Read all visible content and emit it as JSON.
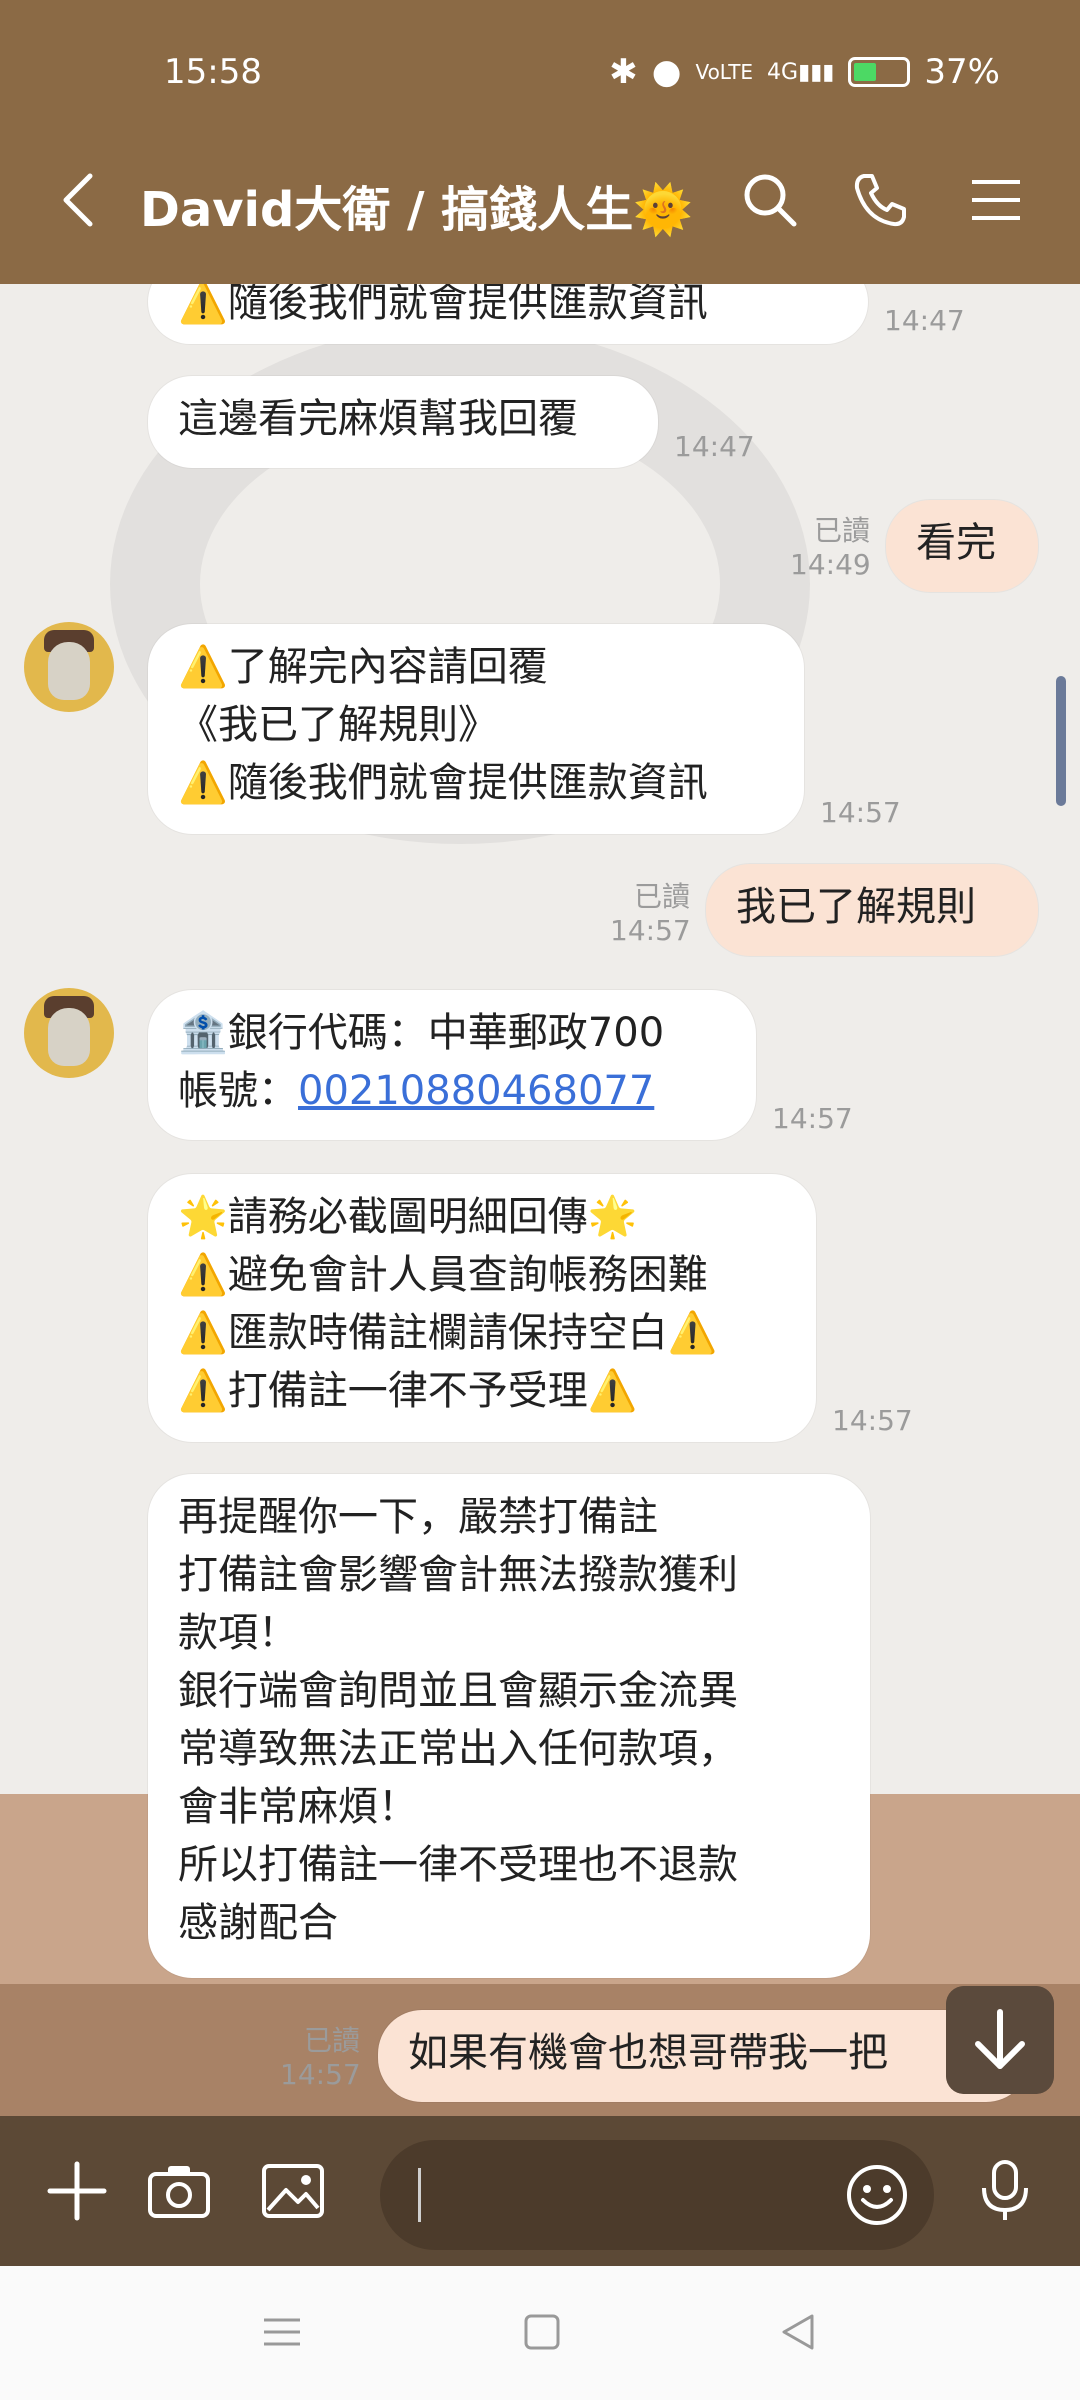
{
  "status_bar": {
    "time": "15:58",
    "battery": "37%"
  },
  "header": {
    "title": "David大衛 / 搞錢人生🌞"
  },
  "messages": [
    {
      "side": "left",
      "lines": [
        "⚠️隨後我們就會提供匯款資訊"
      ],
      "time": "14:47"
    },
    {
      "side": "left",
      "lines": [
        "這邊看完麻煩幫我回覆"
      ],
      "time": "14:47"
    },
    {
      "side": "right",
      "lines": [
        "看完"
      ],
      "read": "已讀",
      "time": "14:49"
    },
    {
      "side": "left",
      "lines": [
        "⚠️了解完內容請回覆",
        "《我已了解規則》",
        "⚠️隨後我們就會提供匯款資訊"
      ],
      "time": "14:57"
    },
    {
      "side": "right",
      "lines": [
        "我已了解規則"
      ],
      "read": "已讀",
      "time": "14:57"
    },
    {
      "side": "left",
      "lines": [
        "🏦銀行代碼：中華郵政700",
        "帳號：",
        "00210880468077"
      ],
      "time": "14:57"
    },
    {
      "side": "left",
      "lines": [
        "🌟請務必截圖明細回傳🌟",
        "⚠️避免會計人員查詢帳務困難",
        "⚠️匯款時備註欄請保持空白⚠️",
        "⚠️打備註一律不予受理⚠️"
      ],
      "time": "14:57"
    },
    {
      "side": "left",
      "lines": [
        "再提醒你一下，嚴禁打備註",
        "打備註會影響會計無法撥款獲利",
        "款項！",
        "銀行端會詢問並且會顯示金流異",
        "常導致無法正常出入任何款項，",
        "會非常麻煩！",
        "所以打備註一律不受理也不退款",
        "感謝配合"
      ]
    },
    {
      "side": "right",
      "lines": [
        "如果有機會也想哥帶我一把"
      ],
      "read": "已讀",
      "time": "14:57"
    }
  ],
  "icons": {
    "back": "back-arrow-icon",
    "search": "search-icon",
    "call": "phone-icon",
    "menu": "menu-icon",
    "add": "plus-icon",
    "camera": "camera-icon",
    "gallery": "image-icon",
    "emoji": "emoji-icon",
    "mic": "mic-icon",
    "jump": "arrow-down-icon"
  },
  "colors": {
    "header": "#8b6a45",
    "my_bubble": "#fbe3d4",
    "their_bubble": "#ffffff",
    "link": "#3a6fd8"
  }
}
